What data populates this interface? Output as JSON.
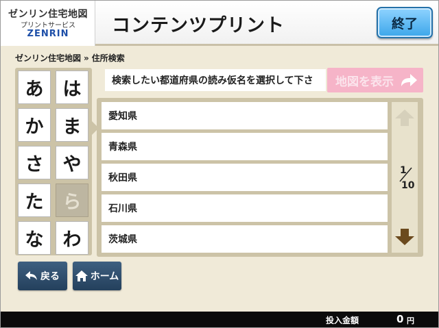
{
  "header": {
    "logo_line1": "ゼンリン住宅地図",
    "logo_line2": "プリントサービス",
    "logo_line3": "ZENRIN",
    "title": "コンテンツプリント",
    "exit_label": "終了"
  },
  "breadcrumb": {
    "home": "ゼンリン住宅地図",
    "separator": "»",
    "current": "住所検索"
  },
  "kana": {
    "items": [
      {
        "label": "あ",
        "enabled": true
      },
      {
        "label": "は",
        "enabled": true
      },
      {
        "label": "か",
        "enabled": true
      },
      {
        "label": "ま",
        "enabled": true
      },
      {
        "label": "さ",
        "enabled": true
      },
      {
        "label": "や",
        "enabled": true
      },
      {
        "label": "た",
        "enabled": true
      },
      {
        "label": "ら",
        "enabled": false
      },
      {
        "label": "な",
        "enabled": true
      },
      {
        "label": "わ",
        "enabled": true
      }
    ]
  },
  "instruction": "検索したい都道府県の読み仮名を選択して下さ",
  "map_button": {
    "label": "地図を表示",
    "icon": "arrow-right-icon",
    "enabled": false
  },
  "prefectures": [
    "愛知県",
    "青森県",
    "秋田県",
    "石川県",
    "茨城県"
  ],
  "pagination": {
    "current": "1",
    "total": "10"
  },
  "nav": {
    "back_label": "戻る",
    "home_label": "ホーム"
  },
  "footer": {
    "label": "投入金額",
    "amount": "0",
    "unit": "円"
  },
  "colors": {
    "background": "#f0ead8",
    "panel": "#ccc3a7",
    "accent_blue": "#3ba6ea",
    "nav_button": "#2f4f6f",
    "map_button_disabled": "#f6b4c8",
    "scroll_arrow": "#6b4a1e"
  }
}
